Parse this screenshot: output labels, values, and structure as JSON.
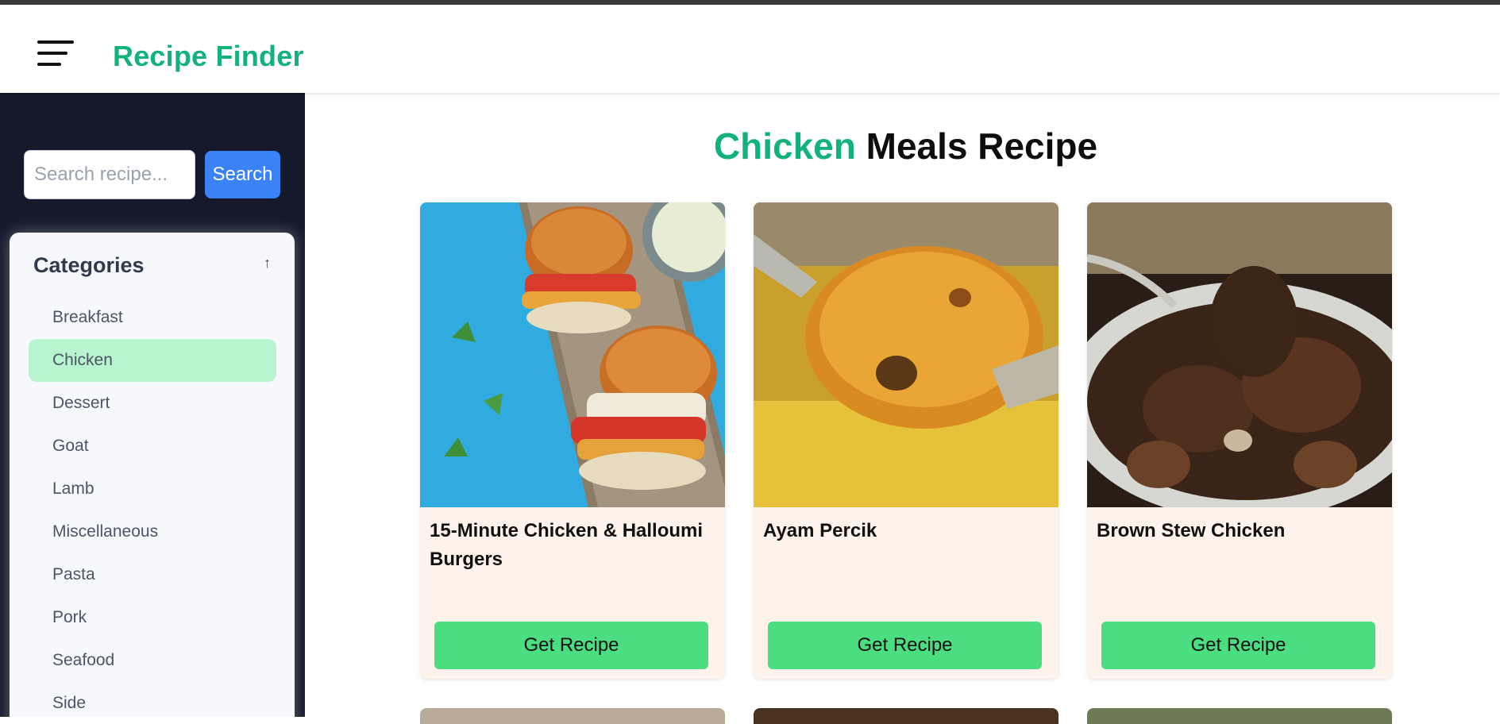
{
  "header": {
    "menu_icon": "hamburger-menu-icon",
    "brand": "Recipe Finder",
    "brand_color": "#13b27a"
  },
  "sidebar": {
    "search_placeholder": "Search recipe...",
    "search_button": "Search",
    "categories_title": "Categories",
    "collapse_icon": "arrow-up-icon",
    "collapse_glyph": "↑",
    "items": [
      {
        "label": "Breakfast"
      },
      {
        "label": "Chicken",
        "active": true
      },
      {
        "label": "Dessert"
      },
      {
        "label": "Goat"
      },
      {
        "label": "Lamb"
      },
      {
        "label": "Miscellaneous"
      },
      {
        "label": "Pasta"
      },
      {
        "label": "Pork"
      },
      {
        "label": "Seafood"
      },
      {
        "label": "Side"
      }
    ]
  },
  "main": {
    "title_accent": "Chicken",
    "title_rest": "Meals Recipe",
    "cards": [
      {
        "name": "15-Minute Chicken & Halloumi Burgers",
        "button": "Get Recipe"
      },
      {
        "name": "Ayam Percik",
        "button": "Get Recipe"
      },
      {
        "name": "Brown Stew Chicken",
        "button": "Get Recipe"
      }
    ]
  },
  "colors": {
    "sidebar_bg": "#141a2b",
    "active_category": "#b7f4cf",
    "search_button": "#3b82f6",
    "recipe_button": "#4ade80",
    "card_bg": "#fdf3ea"
  }
}
